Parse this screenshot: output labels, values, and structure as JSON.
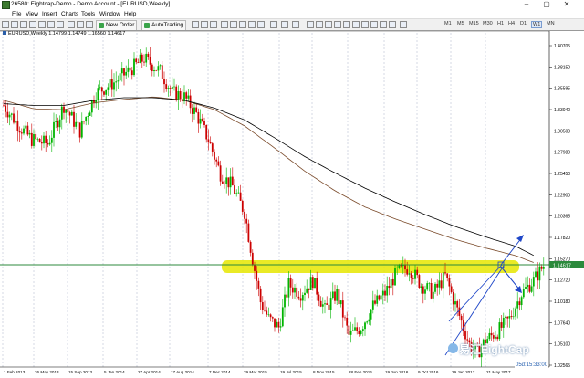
{
  "window": {
    "title": "26580: Eightcap-Demo - Demo Account - [EURUSD,Weekly]",
    "min_glyph": "–",
    "max_glyph": "▢",
    "close_glyph": "✕"
  },
  "menu": [
    "File",
    "View",
    "Insert",
    "Charts",
    "Tools",
    "Window",
    "Help"
  ],
  "toolbar": {
    "new_order": "New Order",
    "autotrading": "AutoTrading",
    "timeframes": [
      "M1",
      "M5",
      "M15",
      "M30",
      "H1",
      "H4",
      "D1",
      "W1",
      "MN"
    ],
    "active_timeframe": "W1"
  },
  "chart": {
    "label": "EURUSD,Weekly  1.14799 1.14749 1.16560 1.14617",
    "countdown": "05d:15:33:00",
    "watermark": "易汇EightCap",
    "current_price_tag": "1.14617",
    "colors": {
      "bull": "#00b400",
      "bear": "#cc0000",
      "ma_black": "#000000",
      "ma_brown": "#7a4a2a",
      "highlight": "#e6e600",
      "support_line": "#2c8a3c",
      "trend_lines": "#1f47c8",
      "grid": "#aab4c8"
    }
  },
  "chart_data": {
    "type": "candlestick",
    "symbol": "EURUSD",
    "timeframe": "Weekly",
    "ohlc_header": {
      "open": 1.14799,
      "high": 1.14749,
      "low": 1.1656,
      "close": 1.14617
    },
    "y_ticks": [
      "1.40705",
      "1.38150",
      "1.35595",
      "1.33040",
      "1.30500",
      "1.27980",
      "1.25450",
      "1.22900",
      "1.20365",
      "1.17820",
      "1.15270",
      "1.12720",
      "1.10180",
      "1.07640",
      "1.05100",
      "1.02565"
    ],
    "x_ticks": [
      "1 Feb 2013",
      "26 May 2013",
      "15 Sep 2013",
      "5 Jan 2014",
      "27 Apr 2014",
      "17 Aug 2014",
      "7 Dec 2014",
      "29 Mar 2015",
      "19 Jul 2015",
      "8 Nov 2015",
      "28 Feb 2016",
      "19 Jun 2016",
      "9 Oct 2016",
      "29 Jan 2017",
      "21 May 2017"
    ],
    "ylim": [
      1.0256,
      1.415
    ],
    "support_level": 1.146,
    "ma_black_anchors": [
      [
        0,
        1.332
      ],
      [
        15,
        1.33
      ],
      [
        30,
        1.33
      ],
      [
        45,
        1.336
      ],
      [
        60,
        1.339
      ],
      [
        75,
        1.339
      ],
      [
        90,
        1.336
      ],
      [
        105,
        1.327
      ],
      [
        120,
        1.313
      ],
      [
        135,
        1.292
      ],
      [
        150,
        1.27
      ],
      [
        165,
        1.251
      ],
      [
        180,
        1.233
      ],
      [
        195,
        1.217
      ],
      [
        210,
        1.202
      ],
      [
        225,
        1.188
      ],
      [
        240,
        1.176
      ],
      [
        255,
        1.165
      ],
      [
        265,
        1.153
      ]
    ],
    "ma_brown_anchors": [
      [
        0,
        1.336
      ],
      [
        15,
        1.326
      ],
      [
        30,
        1.325
      ],
      [
        45,
        1.333
      ],
      [
        60,
        1.337
      ],
      [
        75,
        1.34
      ],
      [
        90,
        1.336
      ],
      [
        105,
        1.325
      ],
      [
        120,
        1.306
      ],
      [
        135,
        1.28
      ],
      [
        150,
        1.253
      ],
      [
        165,
        1.23
      ],
      [
        180,
        1.211
      ],
      [
        195,
        1.197
      ],
      [
        210,
        1.185
      ],
      [
        225,
        1.173
      ],
      [
        240,
        1.163
      ],
      [
        255,
        1.154
      ],
      [
        265,
        1.145
      ]
    ],
    "price_anchors": [
      [
        0,
        1.33
      ],
      [
        8,
        1.305
      ],
      [
        14,
        1.29
      ],
      [
        22,
        1.285
      ],
      [
        30,
        1.33
      ],
      [
        38,
        1.3
      ],
      [
        46,
        1.345
      ],
      [
        54,
        1.355
      ],
      [
        62,
        1.37
      ],
      [
        70,
        1.385
      ],
      [
        78,
        1.37
      ],
      [
        84,
        1.345
      ],
      [
        90,
        1.34
      ],
      [
        96,
        1.32
      ],
      [
        102,
        1.29
      ],
      [
        108,
        1.25
      ],
      [
        114,
        1.235
      ],
      [
        120,
        1.205
      ],
      [
        124,
        1.15
      ],
      [
        128,
        1.1
      ],
      [
        132,
        1.08
      ],
      [
        137,
        1.07
      ],
      [
        142,
        1.12
      ],
      [
        148,
        1.11
      ],
      [
        154,
        1.125
      ],
      [
        160,
        1.09
      ],
      [
        166,
        1.11
      ],
      [
        172,
        1.06
      ],
      [
        178,
        1.07
      ],
      [
        184,
        1.095
      ],
      [
        190,
        1.11
      ],
      [
        196,
        1.135
      ],
      [
        202,
        1.14
      ],
      [
        208,
        1.12
      ],
      [
        214,
        1.11
      ],
      [
        220,
        1.13
      ],
      [
        226,
        1.09
      ],
      [
        232,
        1.05
      ],
      [
        236,
        1.04
      ],
      [
        240,
        1.055
      ],
      [
        246,
        1.065
      ],
      [
        252,
        1.08
      ],
      [
        258,
        1.11
      ],
      [
        264,
        1.125
      ],
      [
        270,
        1.146
      ]
    ]
  }
}
